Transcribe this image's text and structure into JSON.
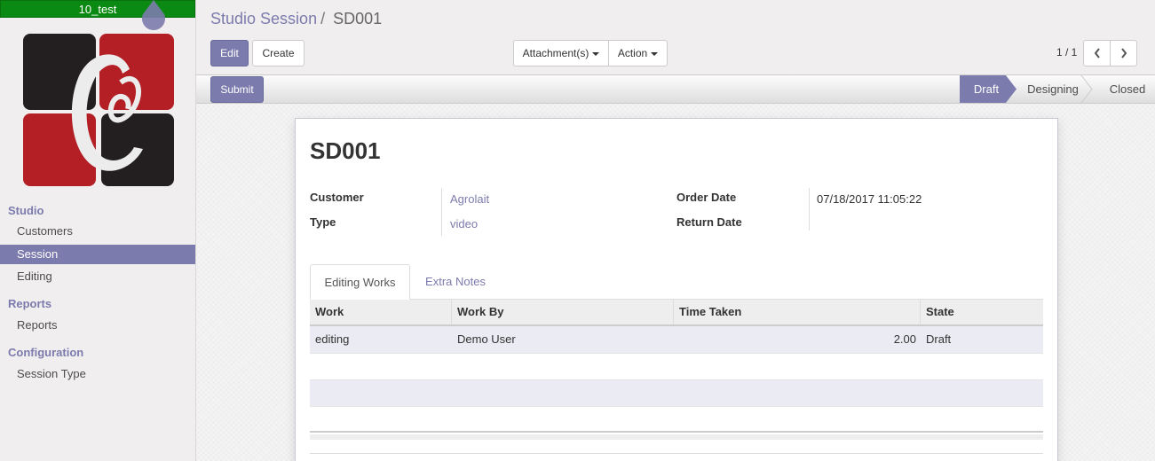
{
  "sidebar": {
    "db_name": "10_test",
    "logo_alt": "Company logo",
    "sections": [
      {
        "title": "Studio",
        "items": [
          "Customers",
          "Session",
          "Editing"
        ]
      },
      {
        "title": "Reports",
        "items": [
          "Reports"
        ]
      },
      {
        "title": "Configuration",
        "items": [
          "Session Type"
        ]
      }
    ],
    "active_item": "Session"
  },
  "breadcrumb": {
    "parent": "Studio Session",
    "separator": "/",
    "current": "SD001"
  },
  "buttons": {
    "edit": "Edit",
    "create": "Create",
    "attachments": "Attachment(s)",
    "action": "Action",
    "submit": "Submit"
  },
  "pager": {
    "text": "1 / 1"
  },
  "statusbar": {
    "stages": [
      "Draft",
      "Designing",
      "Closed"
    ],
    "active": "Draft"
  },
  "record": {
    "title": "SD001",
    "fields": {
      "customer_label": "Customer",
      "customer_value": "Agrolait",
      "type_label": "Type",
      "type_value": "video",
      "order_date_label": "Order Date",
      "order_date_value": "07/18/2017 11:05:22",
      "return_date_label": "Return Date",
      "return_date_value": ""
    }
  },
  "tabs": [
    "Editing Works",
    "Extra Notes"
  ],
  "active_tab": "Editing Works",
  "table": {
    "columns": [
      "Work",
      "Work By",
      "Time Taken",
      "State"
    ],
    "rows": [
      {
        "work": "editing",
        "work_by": "Demo User",
        "time_taken": "2.00",
        "state": "Draft"
      }
    ]
  },
  "colors": {
    "primary": "#7c7bad",
    "db_bar": "#0a8a12"
  }
}
